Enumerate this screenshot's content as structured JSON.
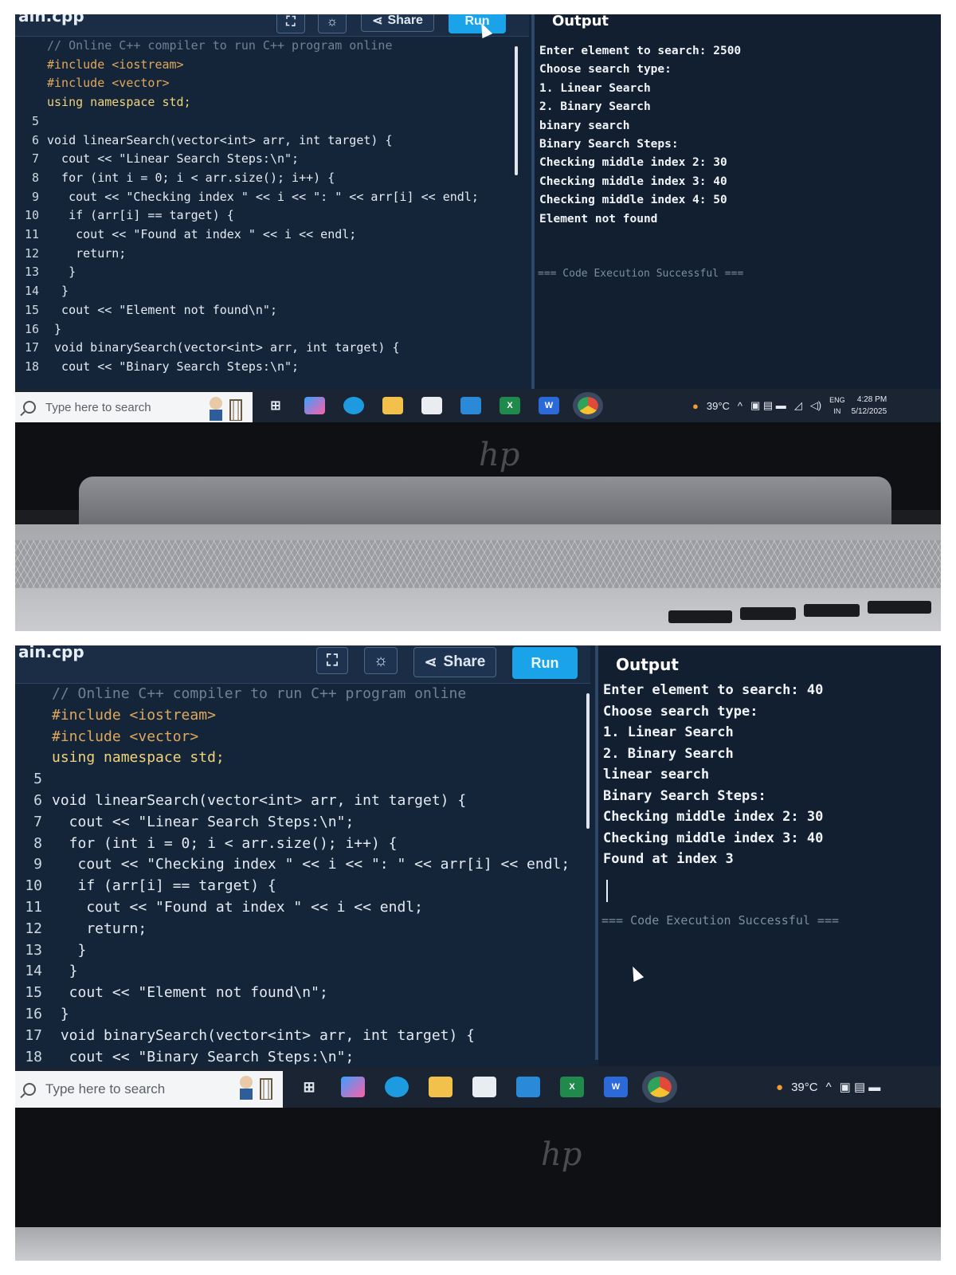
{
  "editor": {
    "filename": "ain.cpp",
    "share_label": "Share",
    "run_label": "Run",
    "output_title": "Output",
    "lines": [
      {
        "n": "",
        "text": "// Online C++ compiler to run C++ program online"
      },
      {
        "n": "",
        "text": "#include <iostream>"
      },
      {
        "n": "",
        "text": "#include <vector>"
      },
      {
        "n": "",
        "text": "using namespace std;"
      },
      {
        "n": "5",
        "text": ""
      },
      {
        "n": "6",
        "text": "void linearSearch(vector<int> arr, int target) {"
      },
      {
        "n": "7",
        "text": "  cout << \"Linear Search Steps:\\n\";"
      },
      {
        "n": "8",
        "text": "  for (int i = 0; i < arr.size(); i++) {"
      },
      {
        "n": "9",
        "text": "   cout << \"Checking index \" << i << \": \" << arr[i] << endl;"
      },
      {
        "n": "10",
        "text": "   if (arr[i] == target) {"
      },
      {
        "n": "11",
        "text": "    cout << \"Found at index \" << i << endl;"
      },
      {
        "n": "12",
        "text": "    return;"
      },
      {
        "n": "13",
        "text": "   }"
      },
      {
        "n": "14",
        "text": "  }"
      },
      {
        "n": "15",
        "text": "  cout << \"Element not found\\n\";"
      },
      {
        "n": "16",
        "text": " }"
      },
      {
        "n": "17",
        "text": " void binarySearch(vector<int> arr, int target) {"
      },
      {
        "n": "18",
        "text": "  cout << \"Binary Search Steps:\\n\";"
      }
    ]
  },
  "run1": {
    "output": [
      "Enter element to search: 2500",
      "Choose search type:",
      "1. Linear Search",
      "2. Binary Search",
      "binary search",
      "Binary Search Steps:",
      "Checking middle index 2: 30",
      "Checking middle index 3: 40",
      "Checking middle index 4: 50",
      "Element not found"
    ],
    "success": "=== Code Execution Successful ==="
  },
  "run2": {
    "output": [
      "Enter element to search: 40",
      "Choose search type:",
      "1. Linear Search",
      "2. Binary Search",
      "linear search",
      "Binary Search Steps:",
      "Checking middle index 2: 30",
      "Checking middle index 3: 40",
      "Found at index 3"
    ],
    "success": "=== Code Execution Successful ==="
  },
  "taskbar": {
    "search_placeholder": "Type here to search",
    "temperature": "39°C",
    "lang_top": "ENG",
    "lang_bottom": "IN",
    "time": "4:28 PM",
    "date": "5/12/2025"
  },
  "laptop": {
    "logo": "hp"
  },
  "icons": [
    "fullscreen-icon",
    "theme-icon",
    "share-icon",
    "search-icon",
    "task-view-icon",
    "copilot-icon",
    "edge-icon",
    "file-explorer-icon",
    "store-icon",
    "outlook-icon",
    "excel-icon",
    "word-icon",
    "chrome-icon",
    "weather-icon"
  ],
  "colors": {
    "editor_bg": "#14253a",
    "output_bg": "#111f31",
    "run_button": "#1aa3e8",
    "keyword": "#f0d37a",
    "preprocessor": "#e2a85a",
    "comment": "#6e8196"
  }
}
